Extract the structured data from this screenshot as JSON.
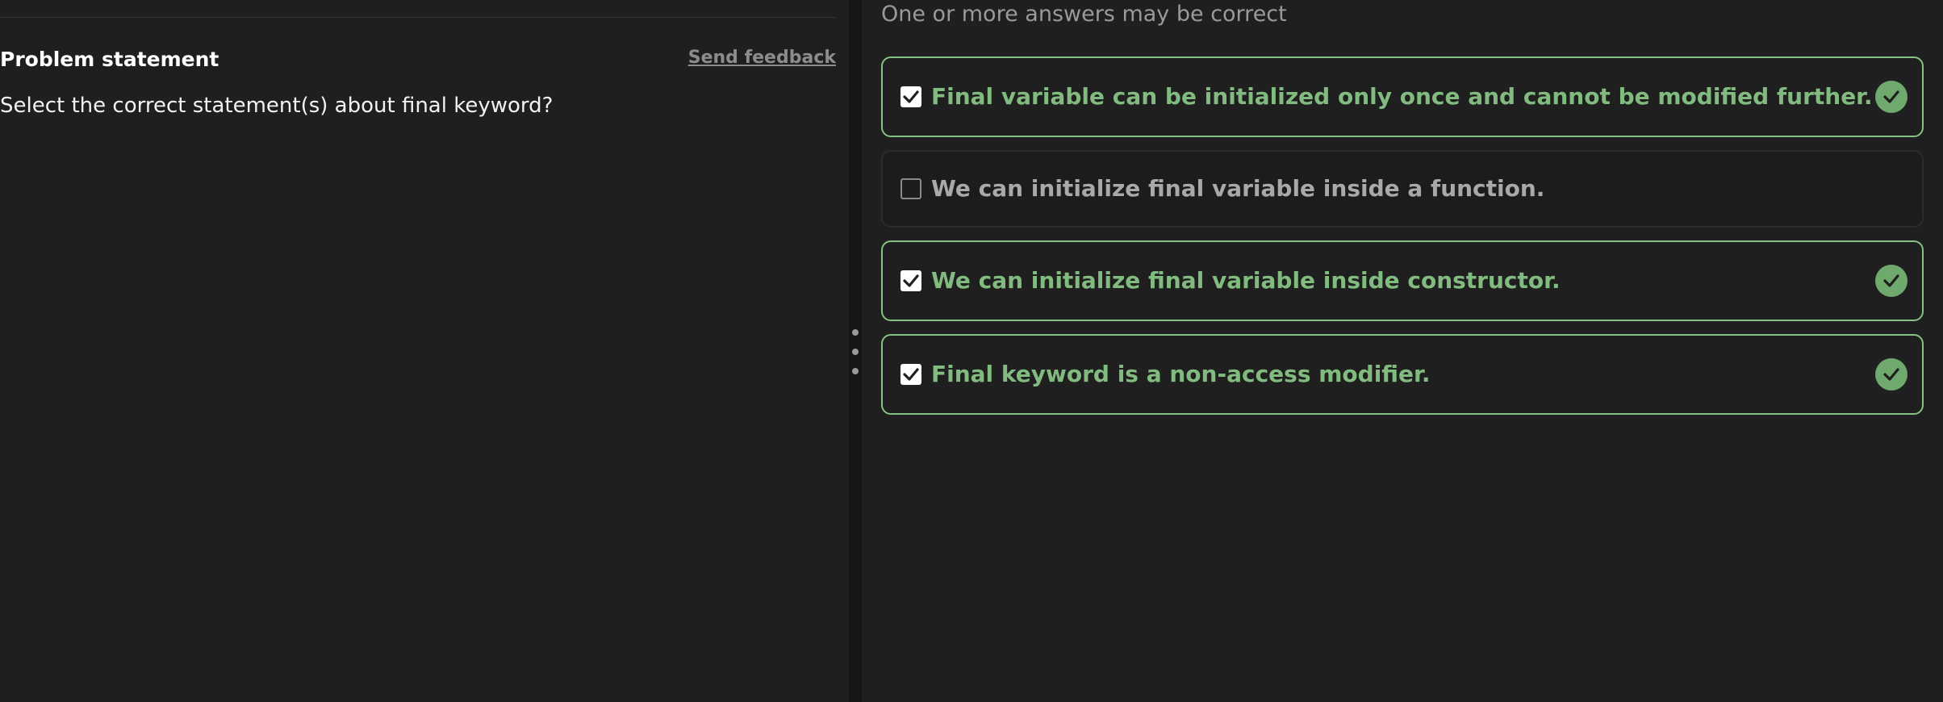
{
  "left_pane": {
    "title": "Problem statement",
    "feedback_link": "Send feedback",
    "question": "Select the correct statement(s) about final keyword?"
  },
  "right_pane": {
    "hint": "One or more answers may be correct",
    "options": [
      {
        "label": "Final variable can be initialized only once and cannot be modified further.",
        "checked": true,
        "status": "correct"
      },
      {
        "label": "We can initialize final variable inside a function.",
        "checked": false,
        "status": "unselected"
      },
      {
        "label": "We can initialize final variable inside constructor.",
        "checked": true,
        "status": "correct"
      },
      {
        "label": "Final keyword is a non-access modifier.",
        "checked": true,
        "status": "correct"
      }
    ]
  },
  "icons": {
    "checkbox_checked": "checkmark-icon",
    "correct_badge": "check-circle-icon",
    "splitter": "vertical-dots-icon"
  },
  "colors": {
    "background": "#1f1f1f",
    "correct_accent": "#86c284",
    "correct_badge": "#6fa96d",
    "muted_text": "#9a9a9a"
  }
}
